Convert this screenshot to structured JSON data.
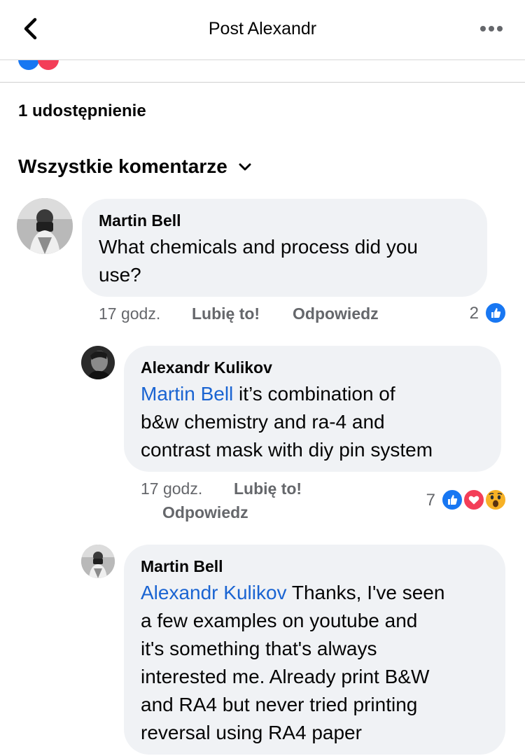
{
  "header": {
    "title": "Post Alexandr"
  },
  "shares": "1 udostępnienie",
  "filter": {
    "label": "Wszystkie komentarze"
  },
  "comments": [
    {
      "author": "Martin Bell",
      "text_lines": [
        "What chemicals and process did you",
        "use?"
      ],
      "time": "17 godz.",
      "like_label": "Lubię to!",
      "reply_label": "Odpowiedz",
      "reaction_count": "2"
    },
    {
      "author": "Alexandr Kulikov",
      "mention": "Martin Bell",
      "text_line1_rest": " it’s combination of",
      "text_lines": [
        "b&w chemistry and ra-4 and",
        "contrast mask with diy pin system"
      ],
      "time": "17 godz.",
      "like_label": "Lubię to!",
      "reply_label": "Odpowiedz",
      "reaction_count": "7"
    },
    {
      "author": "Martin Bell",
      "mention": "Alexandr Kulikov",
      "text_line1_rest": " Thanks, I've seen",
      "text_lines": [
        "a few examples on youtube and",
        "it's something that's always",
        "interested me. Already print B&W",
        "and RA4 but never tried printing",
        "reversal using RA4 paper"
      ]
    }
  ],
  "icons": {
    "back": "chevron-left-icon",
    "more": "more-horizontal-icon",
    "filter": "chevron-down-icon",
    "like": "like-reaction-icon",
    "love": "love-reaction-icon",
    "wow": "wow-reaction-icon"
  },
  "colors": {
    "mention": "#1a64d2",
    "like": "#1877f2",
    "love": "#f33e58",
    "wow": "#f7b125",
    "bubble": "#f0f2f5"
  }
}
